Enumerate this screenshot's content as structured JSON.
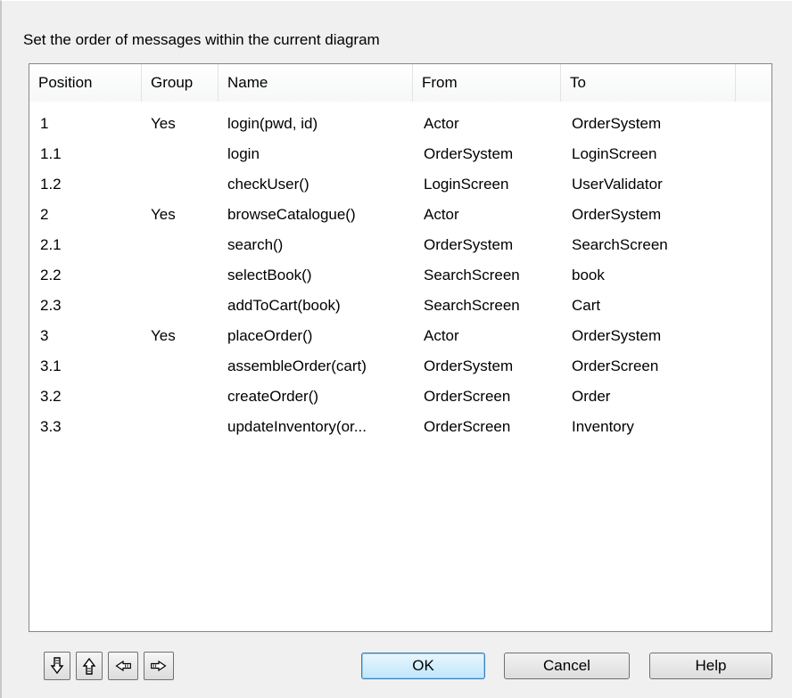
{
  "instruction": "Set the order of messages within the current diagram",
  "columns": [
    "Position",
    "Group",
    "Name",
    "From",
    "To"
  ],
  "rows": [
    {
      "position": "1",
      "group": "Yes",
      "name": "login(pwd, id)",
      "from": "Actor",
      "to": "OrderSystem"
    },
    {
      "position": "1.1",
      "group": "",
      "name": "login",
      "from": "OrderSystem",
      "to": "LoginScreen"
    },
    {
      "position": "1.2",
      "group": "",
      "name": "checkUser()",
      "from": "LoginScreen",
      "to": "UserValidator"
    },
    {
      "position": "2",
      "group": "Yes",
      "name": "browseCatalogue()",
      "from": "Actor",
      "to": "OrderSystem"
    },
    {
      "position": "2.1",
      "group": "",
      "name": "search()",
      "from": "OrderSystem",
      "to": "SearchScreen"
    },
    {
      "position": "2.2",
      "group": "",
      "name": "selectBook()",
      "from": "SearchScreen",
      "to": "book"
    },
    {
      "position": "2.3",
      "group": "",
      "name": "addToCart(book)",
      "from": "SearchScreen",
      "to": "Cart"
    },
    {
      "position": "3",
      "group": "Yes",
      "name": "placeOrder()",
      "from": "Actor",
      "to": "OrderSystem"
    },
    {
      "position": "3.1",
      "group": "",
      "name": "assembleOrder(cart)",
      "from": "OrderSystem",
      "to": "OrderScreen"
    },
    {
      "position": "3.2",
      "group": "",
      "name": "createOrder()",
      "from": "OrderScreen",
      "to": "Order"
    },
    {
      "position": "3.3",
      "group": "",
      "name": "updateInventory(or...",
      "from": "OrderScreen",
      "to": "Inventory"
    }
  ],
  "icons": [
    "move-down-icon",
    "move-up-icon",
    "move-left-icon",
    "move-right-icon"
  ],
  "buttons": {
    "ok": "OK",
    "cancel": "Cancel",
    "help": "Help"
  }
}
